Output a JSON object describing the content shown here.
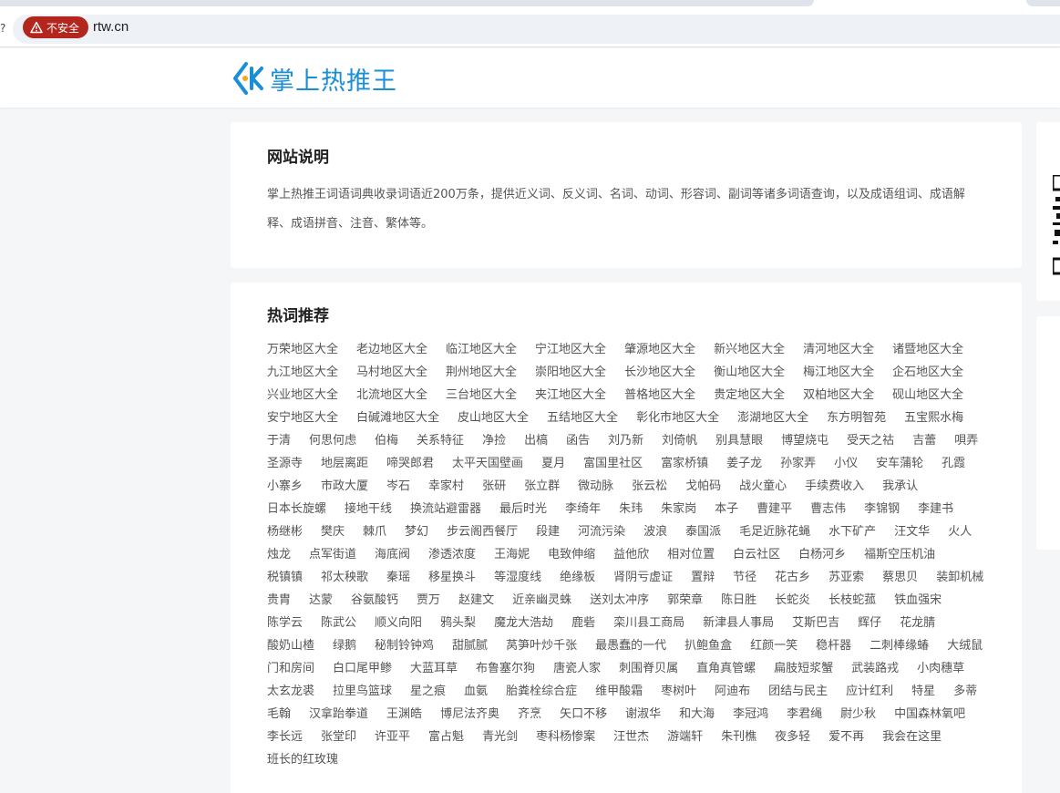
{
  "browser": {
    "security_label": "不安全",
    "url": "rtw.cn"
  },
  "site": {
    "logo_text": "掌上热推王"
  },
  "about": {
    "title": "网站说明",
    "text": "掌上热推王词语词典收录词语近200万条，提供近义词、反义词、名词、动词、形容词、副词等诸多词语查询，以及成语组词、成语解释、成语拼音、注音、繁体等。"
  },
  "hot": {
    "title": "热词推荐",
    "keywords": [
      "万荣地区大全",
      "老边地区大全",
      "临江地区大全",
      "宁江地区大全",
      "肇源地区大全",
      "新兴地区大全",
      "清河地区大全",
      "诸暨地区大全",
      "九江地区大全",
      "马村地区大全",
      "荆州地区大全",
      "崇阳地区大全",
      "长沙地区大全",
      "衡山地区大全",
      "梅江地区大全",
      "企石地区大全",
      "兴业地区大全",
      "北流地区大全",
      "三台地区大全",
      "夹江地区大全",
      "普格地区大全",
      "贵定地区大全",
      "双柏地区大全",
      "砚山地区大全",
      "安宁地区大全",
      "白碱滩地区大全",
      "皮山地区大全",
      "五结地区大全",
      "彰化市地区大全",
      "澎湖地区大全",
      "东方明智苑",
      "五宝熙水梅",
      "于清",
      "何思何虑",
      "伯梅",
      "关系特征",
      "净捡",
      "出槁",
      "函告",
      "刘乃新",
      "刘倚帆",
      "别具慧眼",
      "博望烧屯",
      "受天之祜",
      "吉蕾",
      "唄弄",
      "圣源寺",
      "地层离距",
      "啼哭郎君",
      "太平天国壁画",
      "夏月",
      "富国里社区",
      "富家桥镇",
      "姜子龙",
      "孙家弄",
      "小仪",
      "安车蒲轮",
      "孔霞",
      "小寨乡",
      "市政大厦",
      "岑石",
      "幸家村",
      "张研",
      "张立群",
      "微动脉",
      "张云松",
      "戈帕码",
      "战火童心",
      "手续费收入",
      "我承认",
      "日本长旋螺",
      "接地干线",
      "换流站避雷器",
      "最后时光",
      "李绮年",
      "朱玮",
      "朱家岗",
      "本子",
      "曹建平",
      "曹志伟",
      "李锦钢",
      "李建书",
      "杨继彬",
      "樊庆",
      "棘爪",
      "梦幻",
      "步云阁西餐厅",
      "段建",
      "河流污染",
      "波浪",
      "泰国派",
      "毛足近脉花蝇",
      "水下矿产",
      "汪文华",
      "火人",
      "烛龙",
      "点军街道",
      "海底阀",
      "渗透浓度",
      "王海妮",
      "电致伸缩",
      "益他欣",
      "相对位置",
      "白云社区",
      "白杨河乡",
      "福斯空压机油",
      "税镇镇",
      "祁太秧歌",
      "秦瑶",
      "移星换斗",
      "等湿度线",
      "绝缘板",
      "肾阴亏虚证",
      "置辩",
      "节径",
      "花古乡",
      "苏亚索",
      "蔡思贝",
      "装卸机械",
      "贵胄",
      "达蒙",
      "谷氨酸钙",
      "贾万",
      "赵建文",
      "近亲幽灵蛛",
      "送刘太冲序",
      "郭荣章",
      "陈日胜",
      "长蛇炎",
      "长枝蛇菰",
      "铁血强宋",
      "陈学云",
      "陈武公",
      "顺义向阳",
      "鸦头梨",
      "魔龙大浩劫",
      "鹿砦",
      "栾川县工商局",
      "新津县人事局",
      "艾斯巴吉",
      "辉仔",
      "花龙腈",
      "酸奶山楂",
      "绿鹅",
      "秘制铃钟鸡",
      "甜腻腻",
      "莴笋叶炒千张",
      "最愚蠢的一代",
      "扒鲍鱼盒",
      "红颜一笑",
      "稳杆器",
      "二刺棒缘蝽",
      "大绒鼠",
      "门和房间",
      "白口尾甲鲹",
      "大蓝耳草",
      "布鲁塞尔狗",
      "唐瓷人家",
      "刺围脊贝属",
      "直角真管螺",
      "扁肢短浆蟹",
      "武装路戎",
      "小肉穗草",
      "太玄龙裘",
      "拉里鸟篮球",
      "星之痕",
      "血氨",
      "胎粪栓综合症",
      "维甲酸霜",
      "枣树叶",
      "阿迪布",
      "团结与民主",
      "应计红利",
      "特星",
      "多蒂",
      "毛翰",
      "汉拿跆拳道",
      "王渊皓",
      "博尼法齐奥",
      "齐烹",
      "矢口不移",
      "谢淑华",
      "和大海",
      "李冠鸿",
      "李君绳",
      "尉少秋",
      "中国森林氧吧",
      "李长远",
      "张堂印",
      "许亚平",
      "富占魁",
      "青光剑",
      "枣科杨惨案",
      "汪世杰",
      "游端轩",
      "朱刊樵",
      "夜多轻",
      "爱不再",
      "我会在这里",
      "班长的红玫瑰"
    ]
  },
  "colors": {
    "brand": "#1a8fd6",
    "accent_orange": "#f5a623",
    "insecure_red": "#b3261e"
  }
}
